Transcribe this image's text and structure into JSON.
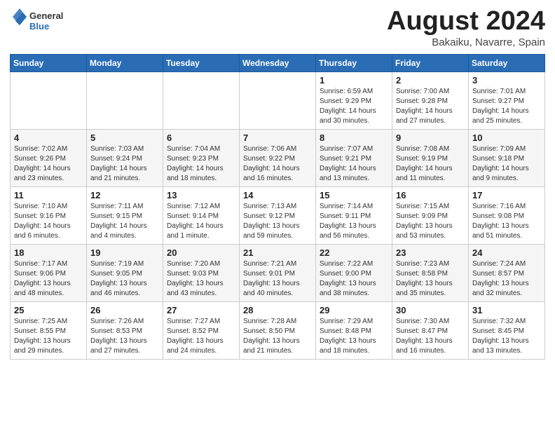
{
  "header": {
    "logo_general": "General",
    "logo_blue": "Blue",
    "title": "August 2024",
    "subtitle": "Bakaiku, Navarre, Spain"
  },
  "weekdays": [
    "Sunday",
    "Monday",
    "Tuesday",
    "Wednesday",
    "Thursday",
    "Friday",
    "Saturday"
  ],
  "weeks": [
    [
      {
        "day": "",
        "info": ""
      },
      {
        "day": "",
        "info": ""
      },
      {
        "day": "",
        "info": ""
      },
      {
        "day": "",
        "info": ""
      },
      {
        "day": "1",
        "info": "Sunrise: 6:59 AM\nSunset: 9:29 PM\nDaylight: 14 hours\nand 30 minutes."
      },
      {
        "day": "2",
        "info": "Sunrise: 7:00 AM\nSunset: 9:28 PM\nDaylight: 14 hours\nand 27 minutes."
      },
      {
        "day": "3",
        "info": "Sunrise: 7:01 AM\nSunset: 9:27 PM\nDaylight: 14 hours\nand 25 minutes."
      }
    ],
    [
      {
        "day": "4",
        "info": "Sunrise: 7:02 AM\nSunset: 9:26 PM\nDaylight: 14 hours\nand 23 minutes."
      },
      {
        "day": "5",
        "info": "Sunrise: 7:03 AM\nSunset: 9:24 PM\nDaylight: 14 hours\nand 21 minutes."
      },
      {
        "day": "6",
        "info": "Sunrise: 7:04 AM\nSunset: 9:23 PM\nDaylight: 14 hours\nand 18 minutes."
      },
      {
        "day": "7",
        "info": "Sunrise: 7:06 AM\nSunset: 9:22 PM\nDaylight: 14 hours\nand 16 minutes."
      },
      {
        "day": "8",
        "info": "Sunrise: 7:07 AM\nSunset: 9:21 PM\nDaylight: 14 hours\nand 13 minutes."
      },
      {
        "day": "9",
        "info": "Sunrise: 7:08 AM\nSunset: 9:19 PM\nDaylight: 14 hours\nand 11 minutes."
      },
      {
        "day": "10",
        "info": "Sunrise: 7:09 AM\nSunset: 9:18 PM\nDaylight: 14 hours\nand 9 minutes."
      }
    ],
    [
      {
        "day": "11",
        "info": "Sunrise: 7:10 AM\nSunset: 9:16 PM\nDaylight: 14 hours\nand 6 minutes."
      },
      {
        "day": "12",
        "info": "Sunrise: 7:11 AM\nSunset: 9:15 PM\nDaylight: 14 hours\nand 4 minutes."
      },
      {
        "day": "13",
        "info": "Sunrise: 7:12 AM\nSunset: 9:14 PM\nDaylight: 14 hours\nand 1 minute."
      },
      {
        "day": "14",
        "info": "Sunrise: 7:13 AM\nSunset: 9:12 PM\nDaylight: 13 hours\nand 59 minutes."
      },
      {
        "day": "15",
        "info": "Sunrise: 7:14 AM\nSunset: 9:11 PM\nDaylight: 13 hours\nand 56 minutes."
      },
      {
        "day": "16",
        "info": "Sunrise: 7:15 AM\nSunset: 9:09 PM\nDaylight: 13 hours\nand 53 minutes."
      },
      {
        "day": "17",
        "info": "Sunrise: 7:16 AM\nSunset: 9:08 PM\nDaylight: 13 hours\nand 51 minutes."
      }
    ],
    [
      {
        "day": "18",
        "info": "Sunrise: 7:17 AM\nSunset: 9:06 PM\nDaylight: 13 hours\nand 48 minutes."
      },
      {
        "day": "19",
        "info": "Sunrise: 7:19 AM\nSunset: 9:05 PM\nDaylight: 13 hours\nand 46 minutes."
      },
      {
        "day": "20",
        "info": "Sunrise: 7:20 AM\nSunset: 9:03 PM\nDaylight: 13 hours\nand 43 minutes."
      },
      {
        "day": "21",
        "info": "Sunrise: 7:21 AM\nSunset: 9:01 PM\nDaylight: 13 hours\nand 40 minutes."
      },
      {
        "day": "22",
        "info": "Sunrise: 7:22 AM\nSunset: 9:00 PM\nDaylight: 13 hours\nand 38 minutes."
      },
      {
        "day": "23",
        "info": "Sunrise: 7:23 AM\nSunset: 8:58 PM\nDaylight: 13 hours\nand 35 minutes."
      },
      {
        "day": "24",
        "info": "Sunrise: 7:24 AM\nSunset: 8:57 PM\nDaylight: 13 hours\nand 32 minutes."
      }
    ],
    [
      {
        "day": "25",
        "info": "Sunrise: 7:25 AM\nSunset: 8:55 PM\nDaylight: 13 hours\nand 29 minutes."
      },
      {
        "day": "26",
        "info": "Sunrise: 7:26 AM\nSunset: 8:53 PM\nDaylight: 13 hours\nand 27 minutes."
      },
      {
        "day": "27",
        "info": "Sunrise: 7:27 AM\nSunset: 8:52 PM\nDaylight: 13 hours\nand 24 minutes."
      },
      {
        "day": "28",
        "info": "Sunrise: 7:28 AM\nSunset: 8:50 PM\nDaylight: 13 hours\nand 21 minutes."
      },
      {
        "day": "29",
        "info": "Sunrise: 7:29 AM\nSunset: 8:48 PM\nDaylight: 13 hours\nand 18 minutes."
      },
      {
        "day": "30",
        "info": "Sunrise: 7:30 AM\nSunset: 8:47 PM\nDaylight: 13 hours\nand 16 minutes."
      },
      {
        "day": "31",
        "info": "Sunrise: 7:32 AM\nSunset: 8:45 PM\nDaylight: 13 hours\nand 13 minutes."
      }
    ]
  ]
}
